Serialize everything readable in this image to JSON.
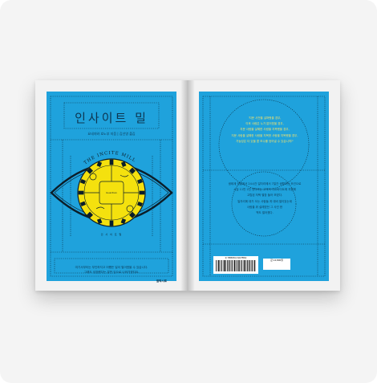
{
  "book": {
    "title_ko": "인사이트 밀",
    "credit_line": "요네자와 호노부 지음 | 김선영 옮김",
    "eye_title": "THE INCITE MILL",
    "eye_subtitle": "인 사 이 트 밀",
    "center_label": "Guardian",
    "blurb_lines": [
      "여기서부터는 부인하지고 어쨌든 일이 벌어졌을 수 있습니다.",
      "그래도 성장했다는 분만 입으로 나와가겠지요."
    ],
    "publisher": "엘릭시르"
  },
  "back_cover": {
    "quote_lines": [
      "'지문 사전을 살펴봤을 경우,",
      "이후 사람은 누가 없어졌을 경우,",
      "지문 사람을 살해한 사람을 지목했을 경우,",
      "지문 사람을 살해한 사람을 지목한 사람을 지목했을 경우,",
      "가능성은 더 있을 뿐 보수를 얻어낼 수 있습니까?'"
    ],
    "desc_lines": [
      "생태계 연결에서 24시간 일자리에서 7일간 생활하는 조건으로",
      "시급 11만 2천 엔이라는 고액의 아르바이트에 지원해",
      "고립된 저택 별장 들어 모였다.",
      "일자리에 대가 오는 사람들 게 대비 벌이었는데",
      "사람을 위 설레였던 그 사건 한",
      "백도 벌어졌다."
    ],
    "barcode_number": "9 788954 647854",
    "price_text": "값 14,800원"
  },
  "colors": {
    "cover_blue": "#1fa2dc",
    "eye_yellow": "#f4e10e",
    "line_dark": "#0b2a3c"
  }
}
